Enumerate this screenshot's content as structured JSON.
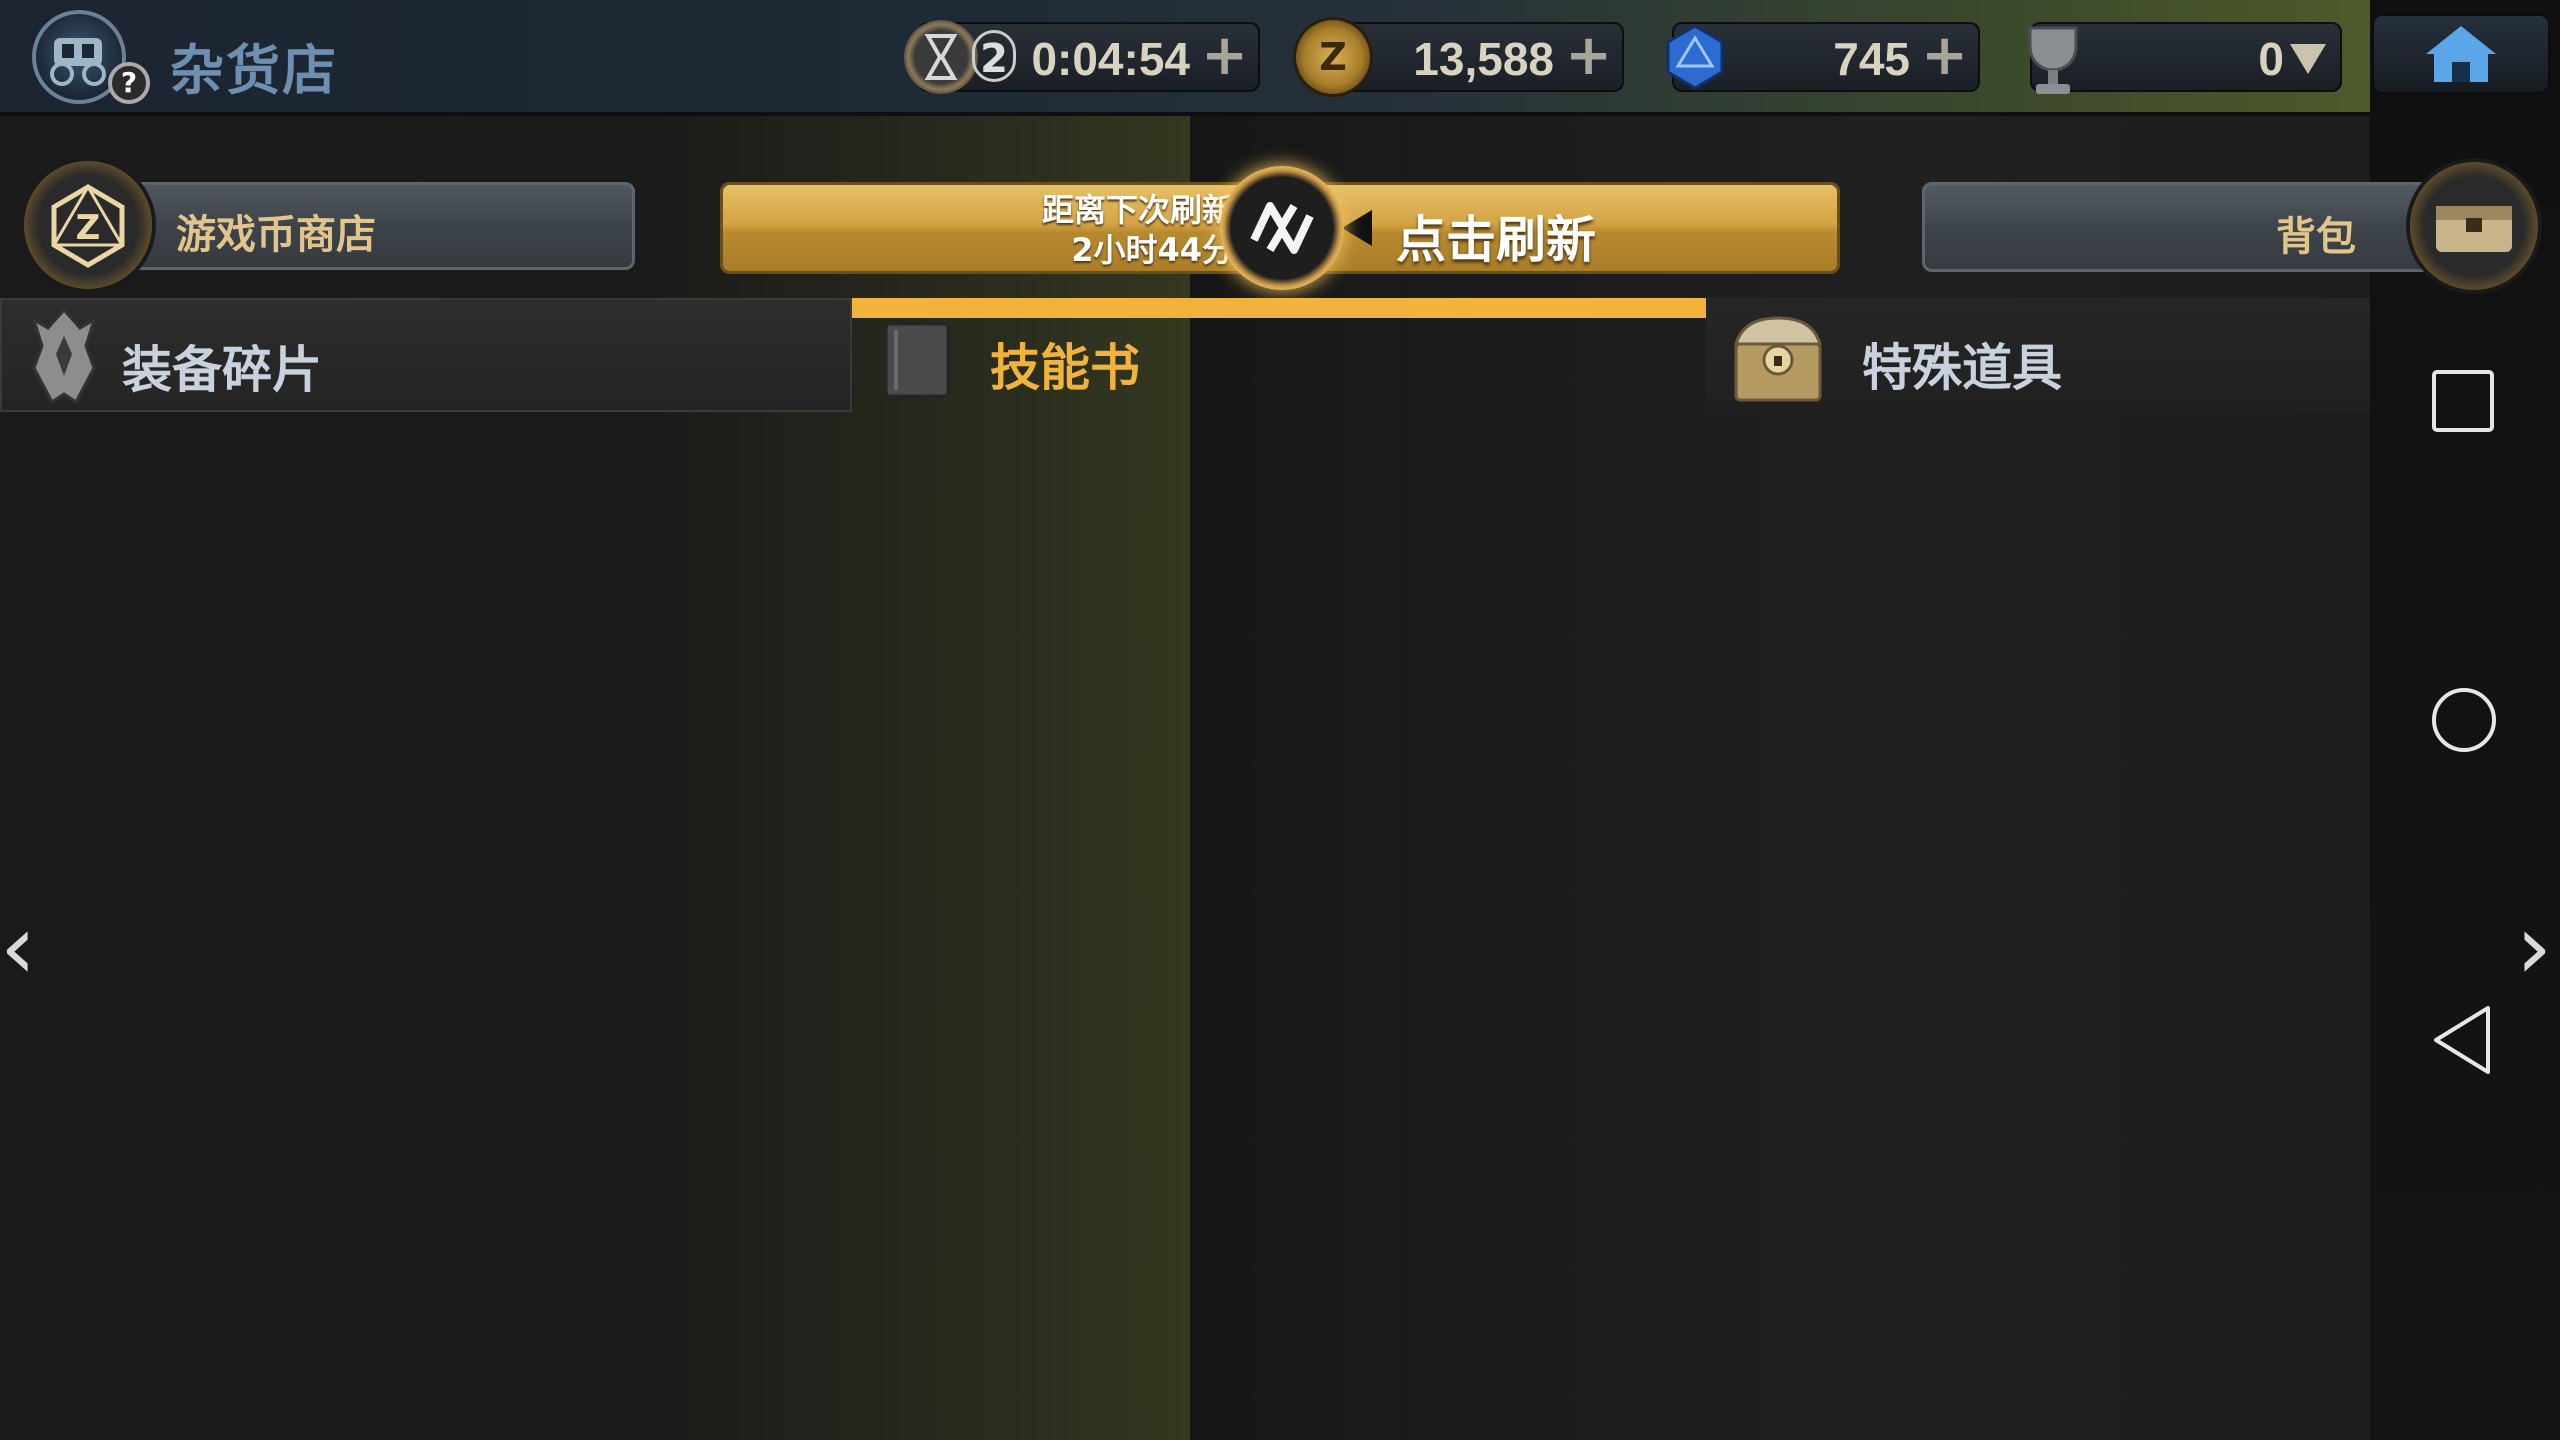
{
  "header": {
    "title": "杂货店",
    "help_icon": "?",
    "resources": [
      {
        "name": "stamina-timer",
        "badge": "2",
        "value": "0:04:54",
        "action": "plus"
      },
      {
        "name": "gold-coin",
        "value": "13,588",
        "action": "plus"
      },
      {
        "name": "blue-gem",
        "value": "745",
        "action": "plus"
      },
      {
        "name": "trophy",
        "value": "0",
        "action": "dropdown"
      }
    ]
  },
  "shop_switch": {
    "label": "游戏币商店"
  },
  "refresh": {
    "info_line1": "距离下次刷新",
    "info_line2": "2小时44分",
    "button_label": "点击刷新"
  },
  "bag": {
    "label": "背包"
  },
  "tabs": [
    {
      "label": "装备碎片",
      "selected": false
    },
    {
      "label": "技能书",
      "selected": true
    },
    {
      "label": "特殊道具",
      "selected": false
    }
  ],
  "nav": {
    "prev": "‹",
    "next": "›"
  },
  "colors": {
    "accent_gold": "#f2b33c",
    "title_blue": "#6f8fb0",
    "selected_tab_text": "#f2b33c",
    "tab_text": "#c9d2dc"
  }
}
